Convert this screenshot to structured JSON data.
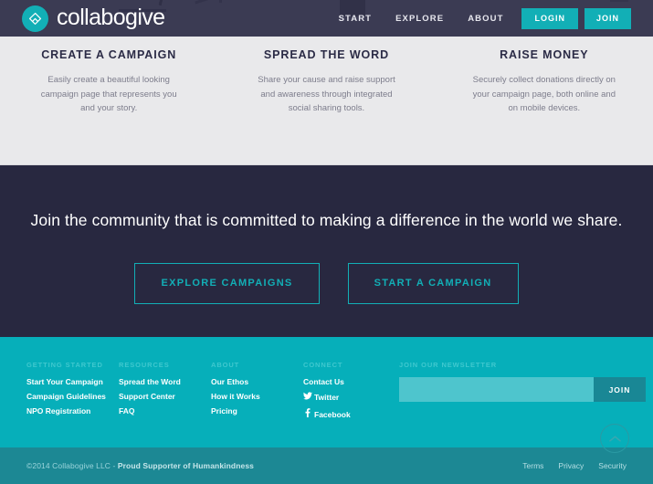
{
  "brand": {
    "name": "collabogive",
    "logo_icon": "diamond-heart-icon",
    "accent_color": "#12AFB6",
    "dark_color": "#282840",
    "footer_teal": "#06AFBA",
    "footer_dark_teal": "#1C8894"
  },
  "header": {
    "nav_links": [
      {
        "label": "START",
        "name": "nav-link-start"
      },
      {
        "label": "EXPLORE",
        "name": "nav-link-explore"
      },
      {
        "label": "ABOUT",
        "name": "nav-link-about"
      }
    ],
    "login_label": "LOGIN",
    "join_label": "JOIN"
  },
  "features": [
    {
      "title": "CREATE A CAMPAIGN",
      "description": "Easily create a beautiful looking campaign page that represents you and your story."
    },
    {
      "title": "SPREAD THE WORD",
      "description": "Share your cause and raise support and awareness through integrated social sharing tools."
    },
    {
      "title": "RAISE MONEY",
      "description": "Securely collect donations directly on your campaign page, both online and on mobile devices."
    }
  ],
  "cta": {
    "heading": "Join the community that is committed to making a difference in the world we share.",
    "explore_label": "EXPLORE CAMPAIGNS",
    "start_label": "START A CAMPAIGN"
  },
  "footer": {
    "columns": [
      {
        "heading": "GETTING STARTED",
        "links": [
          {
            "label": "Start Your Campaign",
            "icon": ""
          },
          {
            "label": "Campaign Guidelines",
            "icon": ""
          },
          {
            "label": "NPO Registration",
            "icon": ""
          }
        ]
      },
      {
        "heading": "RESOURCES",
        "links": [
          {
            "label": "Spread the Word",
            "icon": ""
          },
          {
            "label": "Support Center",
            "icon": ""
          },
          {
            "label": "FAQ",
            "icon": ""
          }
        ]
      },
      {
        "heading": "ABOUT",
        "links": [
          {
            "label": "Our Ethos",
            "icon": ""
          },
          {
            "label": "How it Works",
            "icon": ""
          },
          {
            "label": "Pricing",
            "icon": ""
          }
        ]
      },
      {
        "heading": "CONNECT",
        "links": [
          {
            "label": "Contact Us",
            "icon": ""
          },
          {
            "label": "Twitter",
            "icon": "twitter-icon"
          },
          {
            "label": "Facebook",
            "icon": "facebook-icon"
          }
        ]
      }
    ],
    "newsletter": {
      "heading": "JOIN OUR NEWSLETTER",
      "input_value": "",
      "input_placeholder": "",
      "button_label": "JOIN"
    }
  },
  "bottom": {
    "copyright_prefix": "©2014 Collabogive LLC - ",
    "copyright_strong": "Proud Supporter of Humankindness",
    "legal_links": [
      {
        "label": "Terms"
      },
      {
        "label": "Privacy"
      },
      {
        "label": "Security"
      }
    ],
    "scroll_top_icon": "chevron-up-icon"
  }
}
